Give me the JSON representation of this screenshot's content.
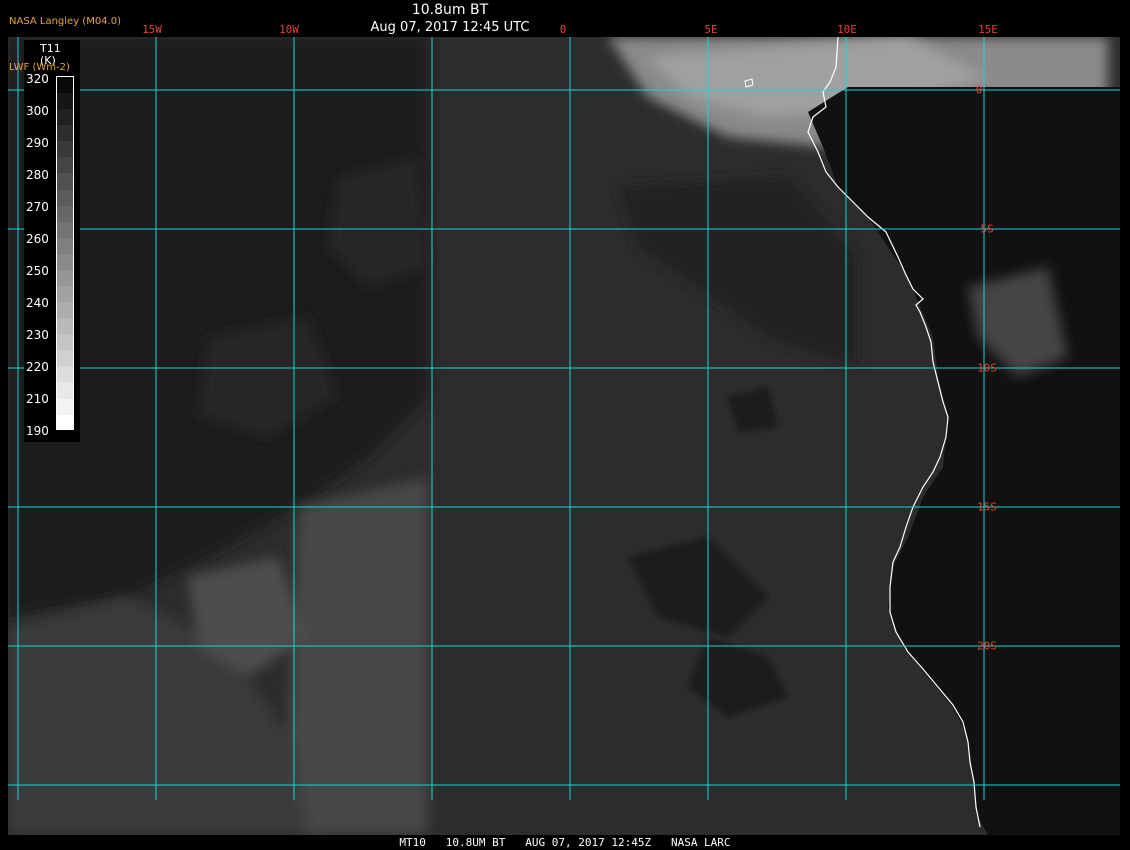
{
  "header": {
    "credit": "NASA Langley (M04.0)",
    "title": "10.8um BT",
    "datetime": "Aug 07, 2017 12:45 UTC"
  },
  "legend": {
    "variable": "T11",
    "units": "(K)",
    "product_label": "LWF (Wm-2)",
    "ticks": [
      "320",
      "300",
      "290",
      "280",
      "270",
      "260",
      "250",
      "240",
      "230",
      "220",
      "210",
      "190"
    ]
  },
  "graticule": {
    "longitudes": [
      {
        "label": "15W",
        "value": -15
      },
      {
        "label": "10W",
        "value": -10
      },
      {
        "label": "0",
        "value": 0
      },
      {
        "label": "5E",
        "value": 5
      },
      {
        "label": "10E",
        "value": 10
      },
      {
        "label": "15E",
        "value": 15
      }
    ],
    "latitudes": [
      {
        "label": "0",
        "value": 0
      },
      {
        "label": "5S",
        "value": -5
      },
      {
        "label": "10S",
        "value": -10
      },
      {
        "label": "15S",
        "value": -15
      },
      {
        "label": "20S",
        "value": -20
      }
    ],
    "line_color": "#19d4d4",
    "label_color": "#e0453a"
  },
  "footer": {
    "text": "MT10   10.8UM BT   AUG 07, 2017 12:45Z   NASA LARC"
  },
  "colors": {
    "ocean": "#2a2a2a",
    "land_dark": "#0f0f0f",
    "coastline": "#ffffff",
    "cloud_high": "#8a8a8a"
  }
}
